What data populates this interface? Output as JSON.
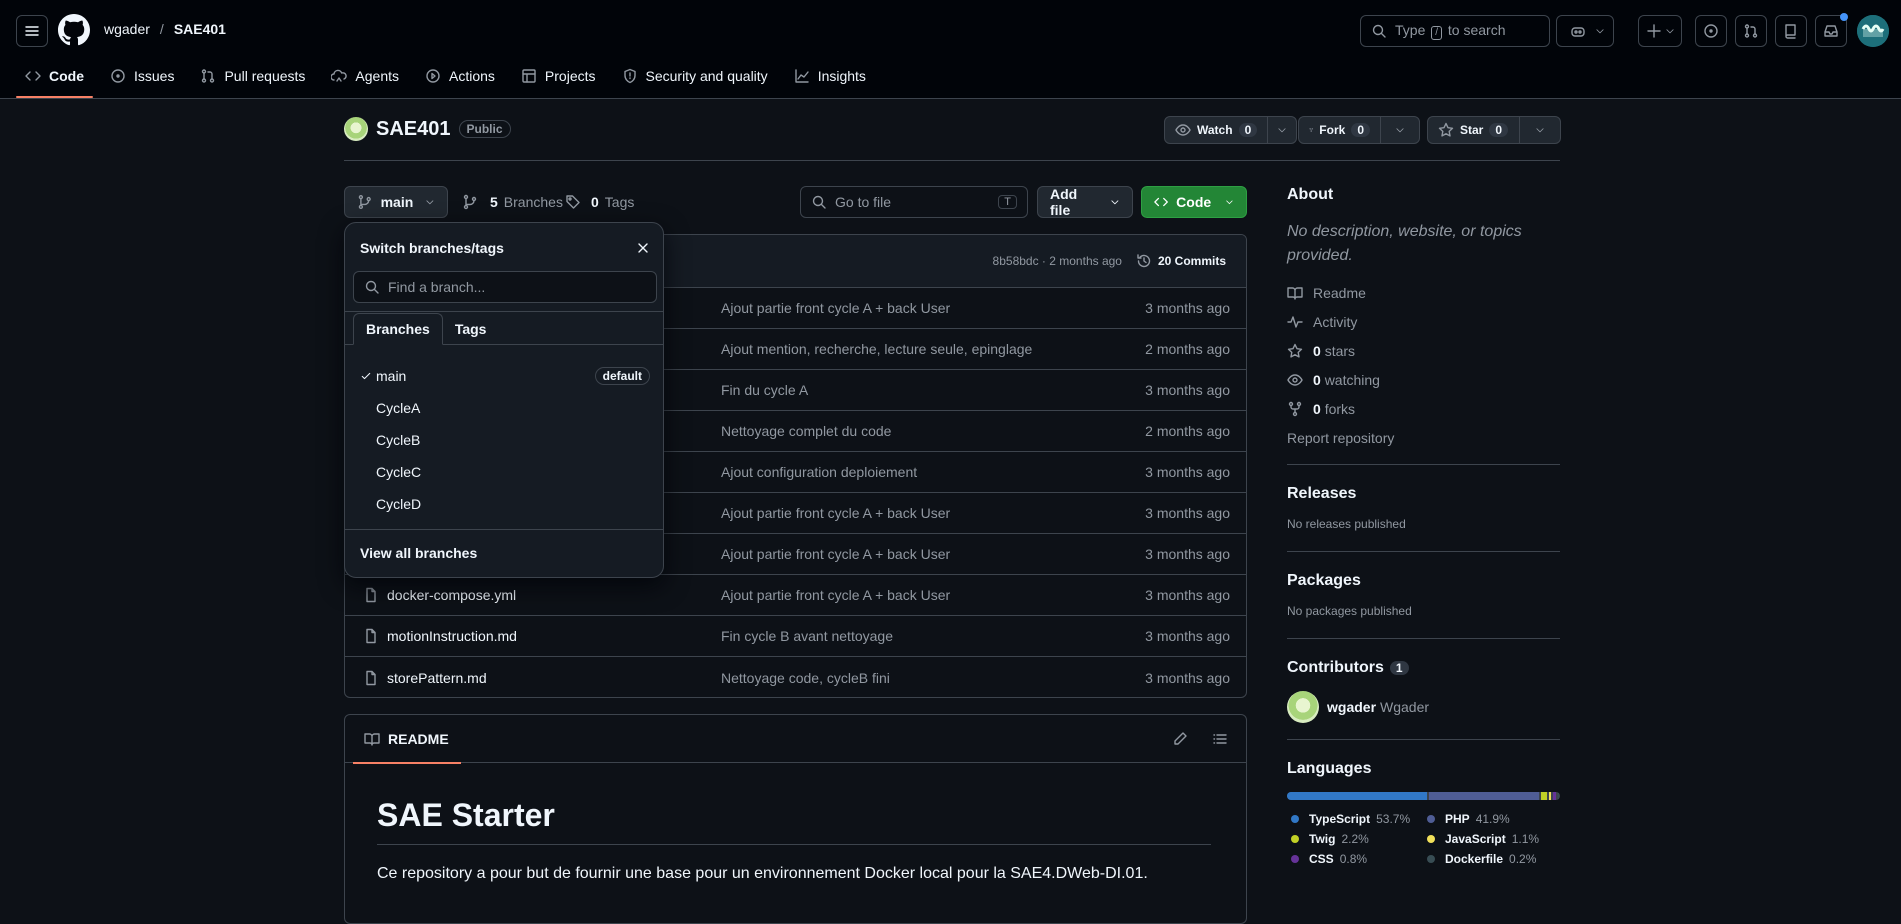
{
  "header": {
    "owner": "wgader",
    "separator": "/",
    "repo": "SAE401",
    "search_prefix": "Type",
    "search_key": "/",
    "search_suffix": "to search"
  },
  "tabs": [
    {
      "label": "Code",
      "icon": "code-icon",
      "active": true
    },
    {
      "label": "Issues",
      "icon": "issue-icon"
    },
    {
      "label": "Pull requests",
      "icon": "pull-request-icon"
    },
    {
      "label": "Agents",
      "icon": "agent-icon"
    },
    {
      "label": "Actions",
      "icon": "play-icon"
    },
    {
      "label": "Projects",
      "icon": "table-icon"
    },
    {
      "label": "Security and quality",
      "icon": "shield-icon"
    },
    {
      "label": "Insights",
      "icon": "graph-icon"
    }
  ],
  "repo": {
    "name": "SAE401",
    "visibility": "Public",
    "watch_label": "Watch",
    "watch_count": "0",
    "fork_label": "Fork",
    "fork_count": "0",
    "star_label": "Star",
    "star_count": "0"
  },
  "filenav": {
    "branch": "main",
    "branches_count": "5",
    "branches_label": "Branches",
    "tags_count": "0",
    "tags_label": "Tags",
    "goto_placeholder": "Go to file",
    "goto_key": "T",
    "add_file": "Add file",
    "code": "Code"
  },
  "commit_header": {
    "hash_time": "8b58bdc · 2 months ago",
    "commits": "20 Commits"
  },
  "files": [
    {
      "name": "",
      "message": "Ajout partie front cycle A + back User",
      "date": "3 months ago"
    },
    {
      "name": "",
      "message": "Ajout mention, recherche, lecture seule, epinglage",
      "date": "2 months ago"
    },
    {
      "name": "",
      "message": "Fin du cycle A",
      "date": "3 months ago"
    },
    {
      "name": "",
      "message": "Nettoyage complet du code",
      "date": "2 months ago"
    },
    {
      "name": "",
      "message": "Ajout configuration deploiement",
      "date": "3 months ago"
    },
    {
      "name": "",
      "message": "Ajout partie front cycle A + back User",
      "date": "3 months ago"
    },
    {
      "name": "",
      "message": "Ajout partie front cycle A + back User",
      "date": "3 months ago"
    },
    {
      "name": "docker-compose.yml",
      "message": "Ajout partie front cycle A + back User",
      "date": "3 months ago"
    },
    {
      "name": "motionInstruction.md",
      "message": "Fin cycle B avant nettoyage",
      "date": "3 months ago"
    },
    {
      "name": "storePattern.md",
      "message": "Nettoyage code, cycleB fini",
      "date": "3 months ago"
    }
  ],
  "dropdown": {
    "title": "Switch branches/tags",
    "find_placeholder": "Find a branch...",
    "tab_branches": "Branches",
    "tab_tags": "Tags",
    "branches": [
      "main",
      "CycleA",
      "CycleB",
      "CycleC",
      "CycleD"
    ],
    "default_label": "default",
    "view_all": "View all branches"
  },
  "readme": {
    "tab": "README",
    "title": "SAE Starter",
    "body": "Ce repository a pour but de fournir une base pour un environnement Docker local pour la SAE4.DWeb-DI.01."
  },
  "sidebar": {
    "about_title": "About",
    "about_desc": "No description, website, or topics provided.",
    "readme": "Readme",
    "activity": "Activity",
    "stars_count": "0",
    "stars_label": "stars",
    "watching_count": "0",
    "watching_label": "watching",
    "forks_count": "0",
    "forks_label": "forks",
    "report": "Report repository",
    "releases_title": "Releases",
    "releases_text": "No releases published",
    "packages_title": "Packages",
    "packages_text": "No packages published",
    "contributors_title": "Contributors",
    "contributors_count": "1",
    "contributor_login": "wgader",
    "contributor_name": "Wgader",
    "languages_title": "Languages"
  },
  "languages": [
    {
      "name": "TypeScript",
      "pct": "53.7%",
      "value": 53.7,
      "color": "#3178c6"
    },
    {
      "name": "PHP",
      "pct": "41.9%",
      "value": 41.9,
      "color": "#4F5D95"
    },
    {
      "name": "Twig",
      "pct": "2.2%",
      "value": 2.2,
      "color": "#c1d026"
    },
    {
      "name": "JavaScript",
      "pct": "1.1%",
      "value": 1.1,
      "color": "#f1e05a"
    },
    {
      "name": "CSS",
      "pct": "0.8%",
      "value": 0.8,
      "color": "#663399"
    },
    {
      "name": "Dockerfile",
      "pct": "0.2%",
      "value": 0.2,
      "color": "#384d54"
    }
  ]
}
